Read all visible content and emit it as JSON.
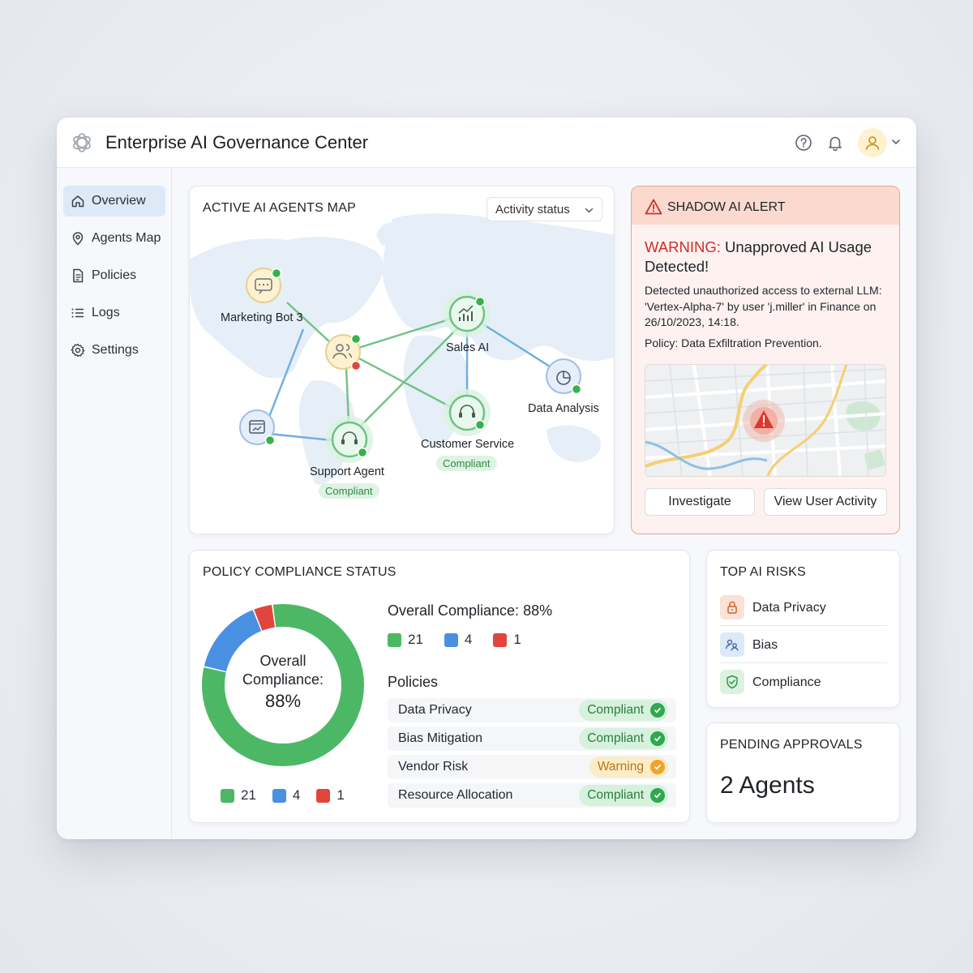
{
  "app": {
    "title": "Enterprise AI Governance Center",
    "logo_icon": "openai-knot-logo"
  },
  "header_icons": [
    "help-circle-icon",
    "bell-icon",
    "user-avatar-icon",
    "chevron-down-icon"
  ],
  "sidebar": {
    "items": [
      {
        "label": "Overview",
        "icon": "home-icon",
        "active": true
      },
      {
        "label": "Agents Map",
        "icon": "map-pin-icon",
        "active": false
      },
      {
        "label": "Policies",
        "icon": "document-icon",
        "active": false
      },
      {
        "label": "Logs",
        "icon": "list-icon",
        "active": false
      },
      {
        "label": "Settings",
        "icon": "gear-icon",
        "active": false
      }
    ]
  },
  "agents_map": {
    "title": "ACTIVE AI AGENTS MAP",
    "filter": {
      "selected": "Activity status"
    },
    "nodes": [
      {
        "label": "Marketing Bot 3",
        "icon": "chat-bubble-icon",
        "status_badge": ""
      },
      {
        "label": "Sales AI",
        "icon": "bar-chart-icon",
        "status_badge": ""
      },
      {
        "label": "Data Analysis",
        "icon": "pie-chart-icon",
        "status_badge": ""
      },
      {
        "label": "Customer Service",
        "icon": "headset-icon",
        "status_badge": "Compliant"
      },
      {
        "label": "Support Agent",
        "icon": "headset-icon",
        "status_badge": "Compliant"
      }
    ]
  },
  "shadow_alert": {
    "title": "SHADOW AI ALERT",
    "warning_prefix": "WARNING:",
    "warning_text": "Unapproved AI Usage Detected!",
    "detail": "Detected unauthorized access to external LLM: 'Vertex-Alpha-7' by user 'j.miller' in Finance on 26/10/2023, 14:18.",
    "policy": "Policy: Data Exfiltration Prevention.",
    "buttons": {
      "investigate": "Investigate",
      "view_activity": "View User Activity"
    },
    "colors": {
      "accent": "#c9302c",
      "header_bg": "#fbd9cf"
    }
  },
  "policy_compliance": {
    "title": "POLICY COMPLIANCE STATUS",
    "donut": {
      "line1": "Overall",
      "line2": "Compliance:",
      "value": "88%"
    },
    "overall_text": "Overall Compliance: 88%",
    "counts": [
      {
        "value": 21,
        "color": "#4cb865"
      },
      {
        "value": 4,
        "color": "#4a90e2"
      },
      {
        "value": 1,
        "color": "#e0463c"
      }
    ],
    "policies_header": "Policies",
    "policies": [
      {
        "name": "Data Privacy",
        "status": "Compliant",
        "kind": "ok"
      },
      {
        "name": "Bias Mitigation",
        "status": "Compliant",
        "kind": "ok"
      },
      {
        "name": "Vendor Risk",
        "status": "Warning",
        "kind": "warn"
      },
      {
        "name": "Resource Allocation",
        "status": "Compliant",
        "kind": "ok"
      }
    ]
  },
  "top_risks": {
    "title": "TOP AI RISKS",
    "items": [
      {
        "label": "Data Privacy",
        "icon": "lock-icon"
      },
      {
        "label": "Bias",
        "icon": "users-scale-icon"
      },
      {
        "label": "Compliance",
        "icon": "shield-check-icon"
      }
    ]
  },
  "pending_approvals": {
    "title": "PENDING APPROVALS",
    "value": "2 Agents"
  }
}
